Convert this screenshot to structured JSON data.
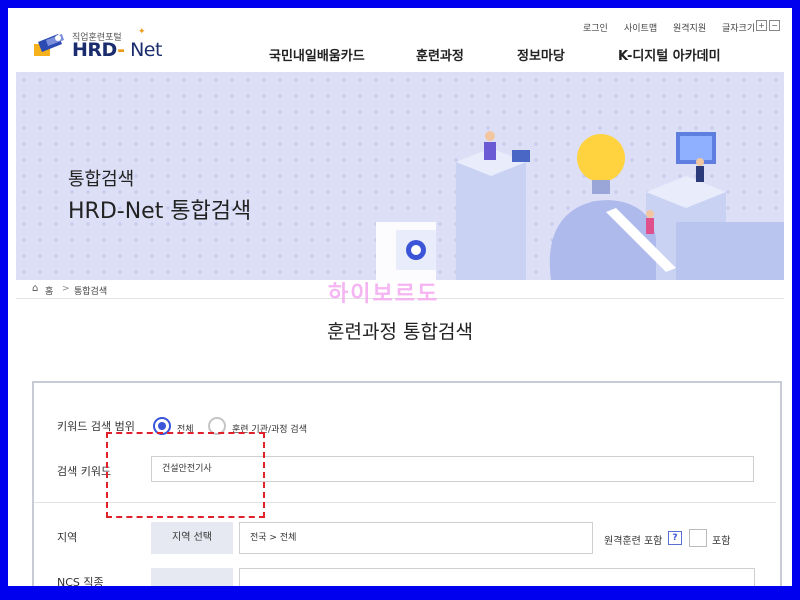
{
  "header": {
    "utility": {
      "login": "로그인",
      "sitemap": "사이트맵",
      "remote_support": "원격지원",
      "font_size": "글자크기",
      "font_plus": "+",
      "font_minus": "−"
    },
    "logo": {
      "subtitle": "직업훈련포털",
      "name_part1": "HRD",
      "name_dash": "-",
      "name_part2": " Net"
    },
    "nav": [
      "국민내일배움카드",
      "훈련과정",
      "정보마당",
      "K-디지털 아카데미"
    ]
  },
  "banner": {
    "title_small": "통합검색",
    "title_large": "HRD-Net 통합검색"
  },
  "breadcrumb": {
    "home": "홈",
    "separator": ">",
    "current": "통합검색"
  },
  "watermark": "하이보르도",
  "page": {
    "title": "훈련과정 통합검색"
  },
  "form": {
    "scope_label": "키워드 검색 범위",
    "scope_options": [
      {
        "label": "전체",
        "selected": true
      },
      {
        "label": "훈련 기관/과정 검색",
        "selected": false
      }
    ],
    "keyword_label": "검색 키워드",
    "keyword_value": "건설안전기사",
    "region_label": "지역",
    "region_button": "지역 선택",
    "region_value": "전국 > 전체",
    "remote_label": "원격훈련 포함",
    "remote_help": "?",
    "remote_include": "포함",
    "ncs_label": "NCS 직종"
  },
  "colors": {
    "border_frame": "#0000ee",
    "accent": "#3b54d8",
    "highlight_dash": "#e0202a",
    "banner_bg": "#dcdff6",
    "watermark": "#f4a8f0"
  }
}
